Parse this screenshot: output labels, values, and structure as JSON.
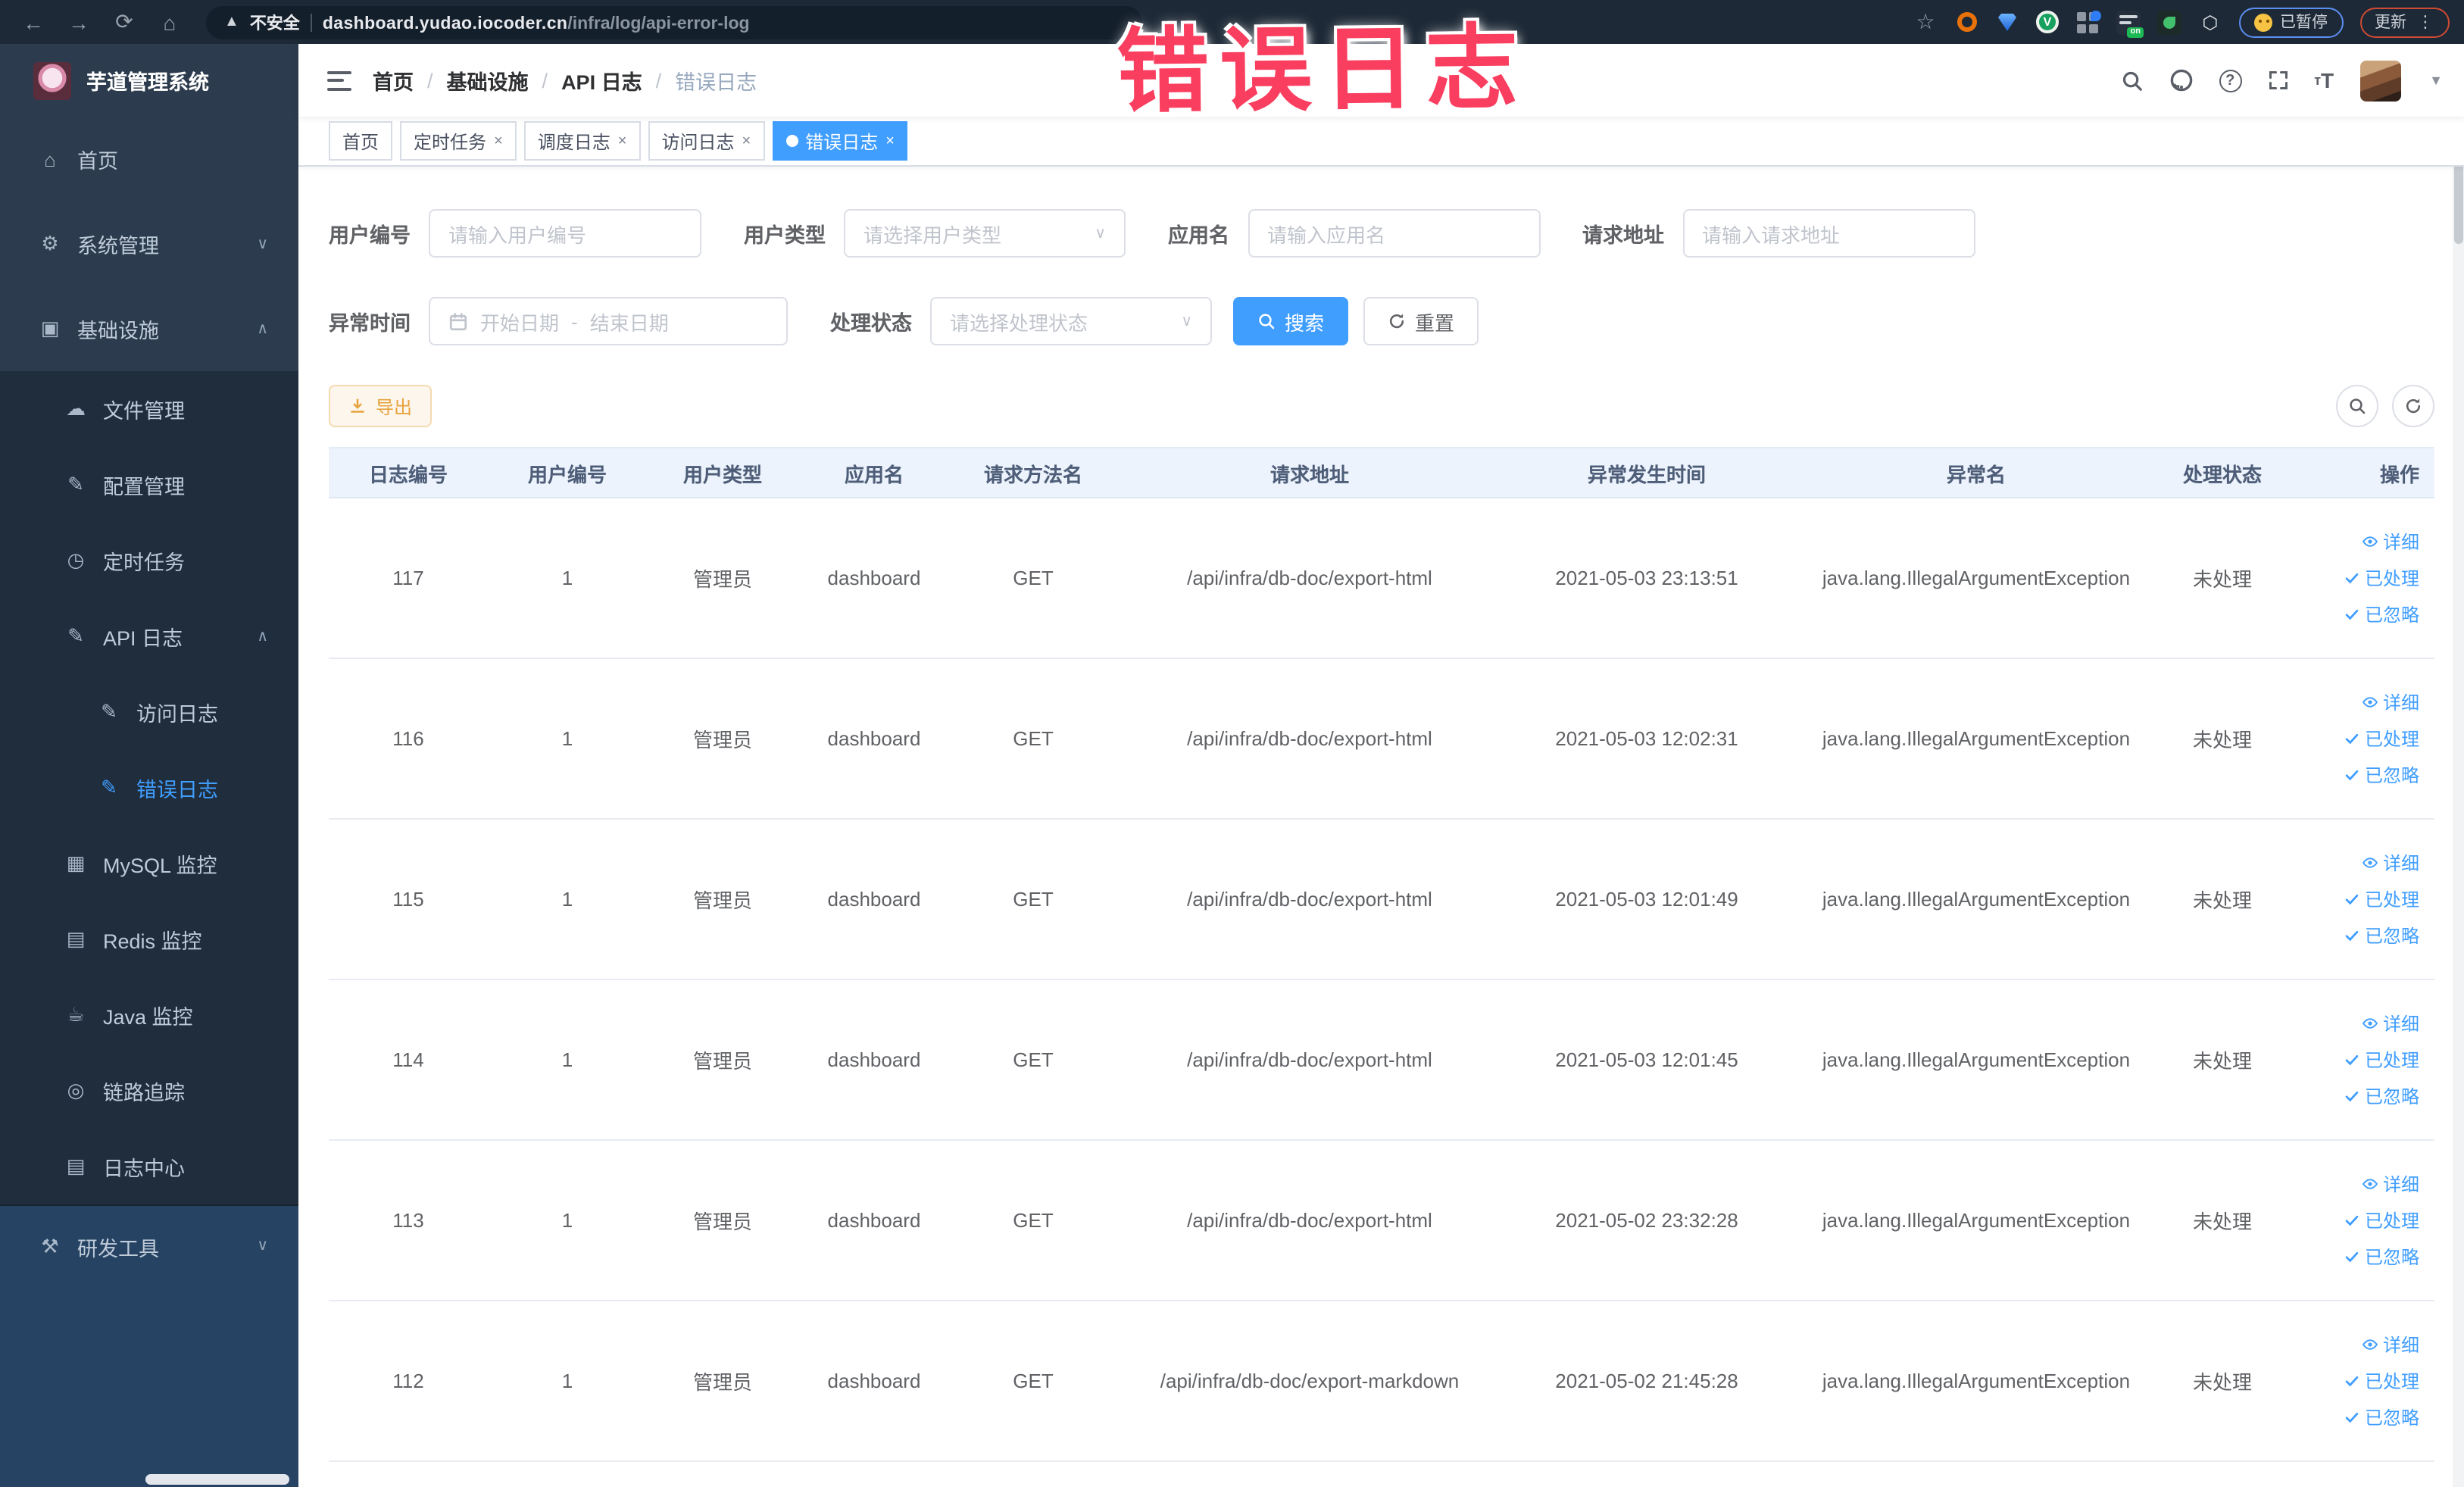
{
  "browser": {
    "security_label": "不安全",
    "url_host": "dashboard.yudao.iocoder.cn",
    "url_path": "/infra/log/api-error-log",
    "paused_label": "已暂停",
    "update_label": "更新"
  },
  "annotation": {
    "text": "错误日志"
  },
  "sidebar": {
    "title": "芋道管理系统",
    "menu": [
      {
        "label": "首页",
        "level": 1,
        "zone": "top",
        "icon": "home-icon"
      },
      {
        "label": "系统管理",
        "level": 1,
        "zone": "top",
        "icon": "gear-icon",
        "chevron": "down"
      },
      {
        "label": "基础设施",
        "level": 1,
        "zone": "top",
        "icon": "infra-icon",
        "chevron": "up"
      },
      {
        "label": "文件管理",
        "level": 2,
        "zone": "sub",
        "icon": "file-icon"
      },
      {
        "label": "配置管理",
        "level": 2,
        "zone": "sub",
        "icon": "config-icon"
      },
      {
        "label": "定时任务",
        "level": 2,
        "zone": "sub",
        "icon": "task-icon"
      },
      {
        "label": "API 日志",
        "level": 2,
        "zone": "sub",
        "icon": "api-log-icon",
        "chevron": "up"
      },
      {
        "label": "访问日志",
        "level": 3,
        "zone": "sub",
        "icon": "access-log-icon"
      },
      {
        "label": "错误日志",
        "level": 3,
        "zone": "sub",
        "icon": "error-log-icon",
        "active": true
      },
      {
        "label": "MySQL 监控",
        "level": 2,
        "zone": "sub",
        "icon": "mysql-icon"
      },
      {
        "label": "Redis 监控",
        "level": 2,
        "zone": "sub",
        "icon": "redis-icon"
      },
      {
        "label": "Java 监控",
        "level": 2,
        "zone": "sub",
        "icon": "java-icon"
      },
      {
        "label": "链路追踪",
        "level": 2,
        "zone": "sub",
        "icon": "trace-icon"
      },
      {
        "label": "日志中心",
        "level": 2,
        "zone": "sub",
        "icon": "log-center-icon"
      },
      {
        "label": "研发工具",
        "level": 1,
        "zone": "light",
        "icon": "tools-icon",
        "chevron": "down"
      }
    ]
  },
  "icon_glyphs": {
    "home-icon": "⌂",
    "gear-icon": "⚙",
    "infra-icon": "▣",
    "file-icon": "☁",
    "config-icon": "✎",
    "task-icon": "◷",
    "api-log-icon": "✎",
    "access-log-icon": "✎",
    "error-log-icon": "✎",
    "mysql-icon": "▦",
    "redis-icon": "▤",
    "java-icon": "☕",
    "trace-icon": "◎",
    "log-center-icon": "▤",
    "tools-icon": "⚒"
  },
  "navbar": {
    "breadcrumb": [
      "首页",
      "基础设施",
      "API 日志",
      "错误日志"
    ],
    "separator": "/"
  },
  "tabs": [
    {
      "label": "首页",
      "closable": false,
      "active": false
    },
    {
      "label": "定时任务",
      "closable": true,
      "active": false
    },
    {
      "label": "调度日志",
      "closable": true,
      "active": false
    },
    {
      "label": "访问日志",
      "closable": true,
      "active": false
    },
    {
      "label": "错误日志",
      "closable": true,
      "active": true
    }
  ],
  "filters": {
    "user_id": {
      "label": "用户编号",
      "placeholder": "请输入用户编号"
    },
    "user_type": {
      "label": "用户类型",
      "placeholder": "请选择用户类型"
    },
    "app_name": {
      "label": "应用名",
      "placeholder": "请输入应用名"
    },
    "request_url": {
      "label": "请求地址",
      "placeholder": "请输入请求地址"
    },
    "exception_time": {
      "label": "异常时间",
      "start_placeholder": "开始日期",
      "separator": "-",
      "end_placeholder": "结束日期"
    },
    "process_status": {
      "label": "处理状态",
      "placeholder": "请选择处理状态"
    },
    "search_label": "搜索",
    "reset_label": "重置"
  },
  "toolbar": {
    "export_label": "导出"
  },
  "table": {
    "columns": [
      "日志编号",
      "用户编号",
      "用户类型",
      "应用名",
      "请求方法名",
      "请求地址",
      "异常发生时间",
      "异常名",
      "处理状态",
      "操作"
    ],
    "actions": [
      "详细",
      "已处理",
      "已忽略"
    ],
    "rows": [
      {
        "log_id": "117",
        "user_id": "1",
        "user_type": "管理员",
        "app": "dashboard",
        "method": "GET",
        "url": "/api/infra/db-doc/export-html",
        "time": "2021-05-03 23:13:51",
        "exception": "java.lang.IllegalArgumentException",
        "status": "未处理"
      },
      {
        "log_id": "116",
        "user_id": "1",
        "user_type": "管理员",
        "app": "dashboard",
        "method": "GET",
        "url": "/api/infra/db-doc/export-html",
        "time": "2021-05-03 12:02:31",
        "exception": "java.lang.IllegalArgumentException",
        "status": "未处理"
      },
      {
        "log_id": "115",
        "user_id": "1",
        "user_type": "管理员",
        "app": "dashboard",
        "method": "GET",
        "url": "/api/infra/db-doc/export-html",
        "time": "2021-05-03 12:01:49",
        "exception": "java.lang.IllegalArgumentException",
        "status": "未处理"
      },
      {
        "log_id": "114",
        "user_id": "1",
        "user_type": "管理员",
        "app": "dashboard",
        "method": "GET",
        "url": "/api/infra/db-doc/export-html",
        "time": "2021-05-03 12:01:45",
        "exception": "java.lang.IllegalArgumentException",
        "status": "未处理"
      },
      {
        "log_id": "113",
        "user_id": "1",
        "user_type": "管理员",
        "app": "dashboard",
        "method": "GET",
        "url": "/api/infra/db-doc/export-html",
        "time": "2021-05-02 23:32:28",
        "exception": "java.lang.IllegalArgumentException",
        "status": "未处理"
      },
      {
        "log_id": "112",
        "user_id": "1",
        "user_type": "管理员",
        "app": "dashboard",
        "method": "GET",
        "url": "/api/infra/db-doc/export-markdown",
        "time": "2021-05-02 21:45:28",
        "exception": "java.lang.IllegalArgumentException",
        "status": "未处理"
      }
    ]
  },
  "colors": {
    "accent": "#409EFF",
    "warning": "#e6a23c",
    "sidebar_dark": "#1f2d3d",
    "annotation": "#fa3e5f"
  }
}
